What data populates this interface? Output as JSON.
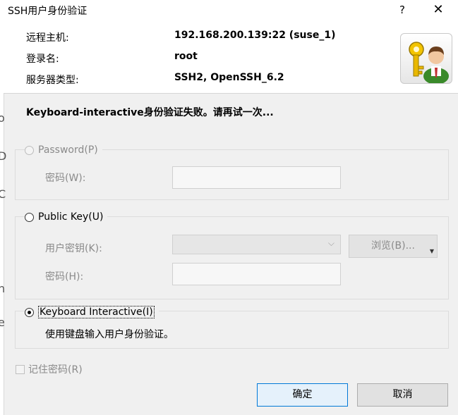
{
  "window": {
    "title": "SSH用户身份验证",
    "help_label": "?",
    "close_label": "✕"
  },
  "header": {
    "host_label": "远程主机:",
    "host_value": "192.168.200.139:22 (suse_1)",
    "login_label": "登录名:",
    "login_value": "root",
    "server_label": "服务器类型:",
    "server_value": "SSH2, OpenSSH_6.2",
    "avatar_icon": "user-key-icon"
  },
  "message": "Keyboard-interactive身份验证失败。请再试一次...",
  "password_group": {
    "label": "Password(P)",
    "field_label": "密码(W):",
    "value": "",
    "selected": false,
    "enabled": false
  },
  "publickey_group": {
    "label": "Public Key(U)",
    "key_label": "用户密钥(K):",
    "key_value": "",
    "browse_label": "浏览(B)...",
    "pass_label": "密码(H):",
    "pass_value": "",
    "selected": false
  },
  "keyboard_group": {
    "label": "Keyboard Interactive(I)",
    "description": "使用键盘输入用户身份验证。",
    "selected": true
  },
  "remember": {
    "label": "记住密码(R)",
    "checked": false
  },
  "buttons": {
    "ok": "确定",
    "cancel": "取消"
  },
  "colors": {
    "primary_border": "#0078d7",
    "window_bg": "#f0f0f0"
  }
}
